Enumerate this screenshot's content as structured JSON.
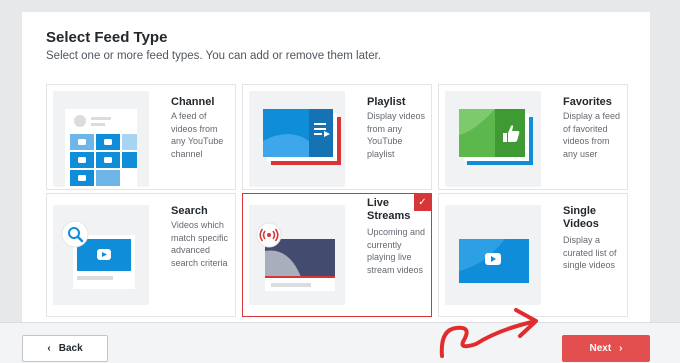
{
  "header": {
    "title": "Select Feed Type",
    "subtitle": "Select one or more feed types. You can add or remove them later."
  },
  "feed_types": [
    {
      "title": "Channel",
      "description": "A feed of videos from any YouTube channel",
      "selected": false
    },
    {
      "title": "Playlist",
      "description": "Display videos from any YouTube playlist",
      "selected": false
    },
    {
      "title": "Favorites",
      "description": "Display a feed of favorited videos from any user",
      "selected": false
    },
    {
      "title": "Search",
      "description": "Videos which match specific advanced search criteria",
      "selected": false
    },
    {
      "title": "Live Streams",
      "description": "Upcoming and currently playing live stream videos",
      "selected": true
    },
    {
      "title": "Single Videos",
      "description": "Display a curated list of single videos",
      "selected": false
    }
  ],
  "footer": {
    "back_label": "Back",
    "next_label": "Next"
  },
  "colors": {
    "accent": "#e34f4f",
    "youtube_blue": "#0f8dd8",
    "favorites_green": "#5cb84d",
    "selected_border": "#d63638"
  },
  "icons": [
    "search-icon",
    "broadcast-icon",
    "play-icon",
    "thumbs-up-icon",
    "checkmark-icon",
    "chevron-left-icon",
    "chevron-right-icon",
    "curved-arrow-icon"
  ]
}
